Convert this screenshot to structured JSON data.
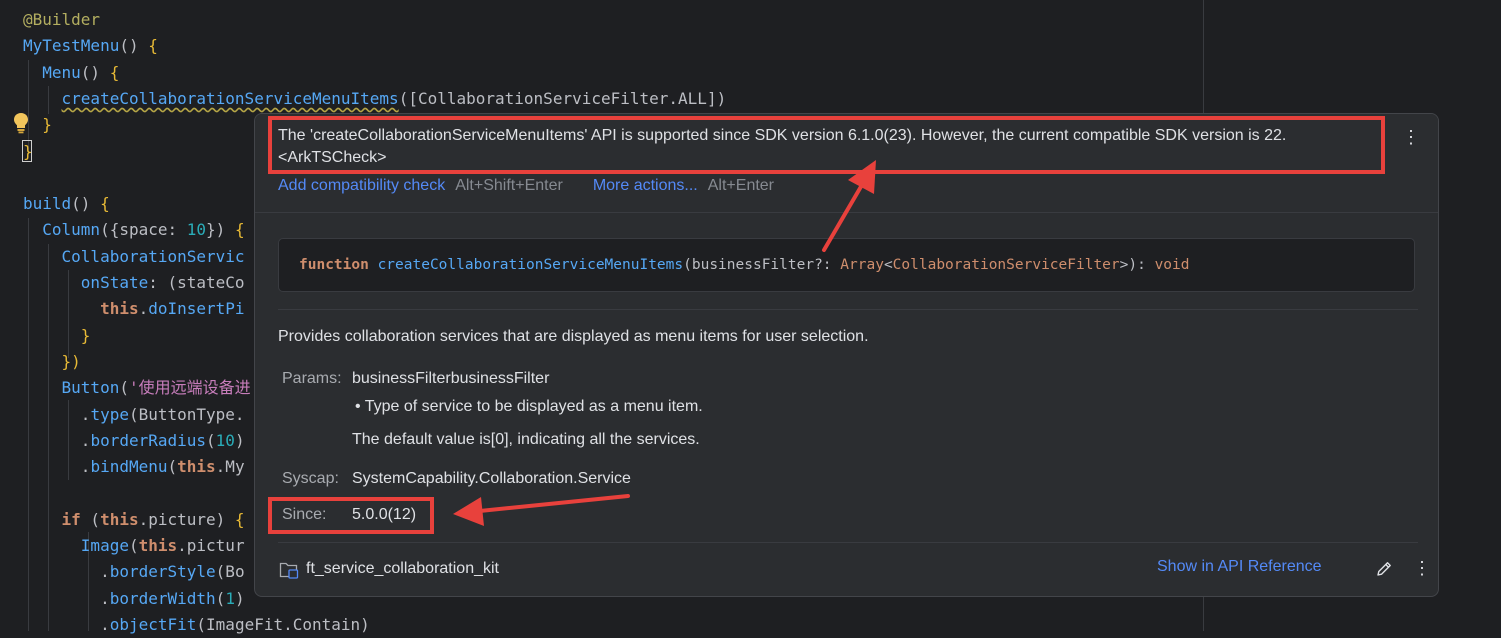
{
  "editor": {
    "lines": [
      {
        "parts": [
          {
            "t": "@Builder",
            "c": "ann"
          }
        ]
      },
      {
        "parts": [
          {
            "t": "MyTestMenu",
            "c": "fn"
          },
          {
            "t": "() ",
            "c": ""
          },
          {
            "t": "{",
            "c": "brace"
          }
        ]
      },
      {
        "parts": [
          {
            "t": "  Menu",
            "c": "fn"
          },
          {
            "t": "() ",
            "c": ""
          },
          {
            "t": "{",
            "c": "brace"
          }
        ]
      },
      {
        "parts": [
          {
            "t": "    ",
            "c": ""
          },
          {
            "t": "createCollaborationServiceMenuItems",
            "c": "fn warn-underline"
          },
          {
            "t": "([CollaborationServiceFilter.ALL])",
            "c": ""
          }
        ]
      },
      {
        "parts": [
          {
            "t": "  ",
            "c": ""
          },
          {
            "t": "}",
            "c": "brace"
          }
        ]
      },
      {
        "parts": [
          {
            "t": "}",
            "c": "brace"
          }
        ]
      },
      {
        "parts": [
          {
            "t": "",
            "c": ""
          }
        ]
      },
      {
        "parts": [
          {
            "t": "build",
            "c": "fn"
          },
          {
            "t": "() ",
            "c": ""
          },
          {
            "t": "{",
            "c": "brace"
          }
        ]
      },
      {
        "parts": [
          {
            "t": "  Column",
            "c": "fn"
          },
          {
            "t": "({",
            "c": ""
          },
          {
            "t": "space",
            "c": ""
          },
          {
            "t": ": ",
            "c": ""
          },
          {
            "t": "10",
            "c": "num"
          },
          {
            "t": "}) ",
            "c": ""
          },
          {
            "t": "{",
            "c": "brace"
          }
        ]
      },
      {
        "parts": [
          {
            "t": "    CollaborationServic",
            "c": "fn"
          }
        ]
      },
      {
        "parts": [
          {
            "t": "      onState",
            "c": "fn"
          },
          {
            "t": ": (stateCo",
            "c": ""
          }
        ]
      },
      {
        "parts": [
          {
            "t": "        ",
            "c": ""
          },
          {
            "t": "this",
            "c": "kw"
          },
          {
            "t": ".",
            "c": ""
          },
          {
            "t": "doInsertPi",
            "c": "fn"
          }
        ]
      },
      {
        "parts": [
          {
            "t": "      ",
            "c": ""
          },
          {
            "t": "}",
            "c": "brace"
          }
        ]
      },
      {
        "parts": [
          {
            "t": "    })",
            "c": "brace"
          }
        ]
      },
      {
        "parts": [
          {
            "t": "    Button",
            "c": "fn"
          },
          {
            "t": "(",
            "c": ""
          },
          {
            "t": "'使用远端设备进",
            "c": "str"
          }
        ]
      },
      {
        "parts": [
          {
            "t": "      .",
            "c": ""
          },
          {
            "t": "type",
            "c": "fn"
          },
          {
            "t": "(ButtonType.",
            "c": ""
          }
        ]
      },
      {
        "parts": [
          {
            "t": "      .",
            "c": ""
          },
          {
            "t": "borderRadius",
            "c": "fn"
          },
          {
            "t": "(",
            "c": ""
          },
          {
            "t": "10",
            "c": "num"
          },
          {
            "t": ")",
            "c": ""
          }
        ]
      },
      {
        "parts": [
          {
            "t": "      .",
            "c": ""
          },
          {
            "t": "bindMenu",
            "c": "fn"
          },
          {
            "t": "(",
            "c": ""
          },
          {
            "t": "this",
            "c": "kw"
          },
          {
            "t": ".My",
            "c": ""
          }
        ]
      },
      {
        "parts": [
          {
            "t": "",
            "c": ""
          }
        ]
      },
      {
        "parts": [
          {
            "t": "    ",
            "c": ""
          },
          {
            "t": "if",
            "c": "kw"
          },
          {
            "t": " (",
            "c": ""
          },
          {
            "t": "this",
            "c": "kw"
          },
          {
            "t": ".picture) ",
            "c": ""
          },
          {
            "t": "{",
            "c": "brace"
          }
        ]
      },
      {
        "parts": [
          {
            "t": "      Image",
            "c": "fn"
          },
          {
            "t": "(",
            "c": ""
          },
          {
            "t": "this",
            "c": "kw"
          },
          {
            "t": ".pictur",
            "c": ""
          }
        ]
      },
      {
        "parts": [
          {
            "t": "        .",
            "c": ""
          },
          {
            "t": "borderStyle",
            "c": "fn"
          },
          {
            "t": "(Bo",
            "c": ""
          }
        ]
      },
      {
        "parts": [
          {
            "t": "        .",
            "c": ""
          },
          {
            "t": "borderWidth",
            "c": "fn"
          },
          {
            "t": "(",
            "c": ""
          },
          {
            "t": "1",
            "c": "num"
          },
          {
            "t": ")",
            "c": ""
          }
        ]
      },
      {
        "parts": [
          {
            "t": "        .",
            "c": ""
          },
          {
            "t": "objectFit",
            "c": "fn"
          },
          {
            "t": "(ImageFit.Contain)",
            "c": ""
          }
        ]
      }
    ]
  },
  "popup": {
    "warning_line1": "The 'createCollaborationServiceMenuItems' API is supported since SDK version 6.1.0(23). However, the current compatible SDK version is 22.",
    "warning_line2": "<ArkTSCheck>",
    "action1_label": "Add compatibility check",
    "action1_shortcut": "Alt+Shift+Enter",
    "action2_label": "More actions...",
    "action2_shortcut": "Alt+Enter",
    "signature": {
      "kw": "function",
      "name": "createCollaborationServiceMenuItems",
      "param": "businessFilter",
      "opt": "?: ",
      "type": "Array",
      "generic": "CollaborationServiceFilter",
      "ret": "void"
    },
    "description": "Provides collaboration services that are displayed as menu items for user selection.",
    "params_label": "Params:",
    "params_value": "businessFilterbusinessFilter",
    "params_bullet": "• Type of service to be displayed as a menu item.",
    "params_default": "The default value is[0], indicating all the services.",
    "syscap_label": "Syscap:",
    "syscap_value": "SystemCapability.Collaboration.Service",
    "since_label": "Since:",
    "since_value": "5.0.0(12)",
    "module": "ft_service_collaboration_kit",
    "api_reference": "Show in API Reference"
  },
  "colors": {
    "highlight": "#e8413c",
    "link": "#548af7",
    "background": "#1e1f22",
    "popup_background": "#2b2d30"
  }
}
